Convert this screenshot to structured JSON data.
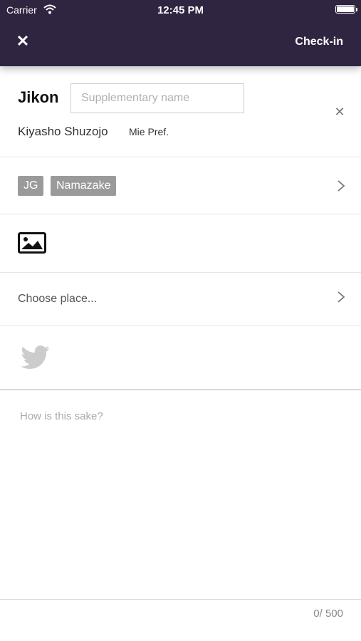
{
  "status_bar": {
    "carrier": "Carrier",
    "time": "12:45 PM"
  },
  "nav": {
    "close_glyph": "✕",
    "checkin_label": "Check-in"
  },
  "sake": {
    "name": "Jikon",
    "supplementary_placeholder": "Supplementary name",
    "brewery": "Kiyasho Shuzojo",
    "prefecture": "Mie Pref.",
    "remove_glyph": "✕"
  },
  "tags": [
    "JG",
    "Namazake"
  ],
  "place": {
    "placeholder": "Choose place..."
  },
  "comment": {
    "placeholder": "How is this sake?"
  },
  "counter": "0/ 500",
  "colors": {
    "nav_bg": "#2f2541",
    "tag_bg": "#9a9a9a",
    "twitter_icon": "#cccccc"
  },
  "icons": [
    "wifi-icon",
    "battery-icon",
    "close-icon",
    "photo-icon",
    "chevron-right-icon",
    "twitter-icon"
  ]
}
